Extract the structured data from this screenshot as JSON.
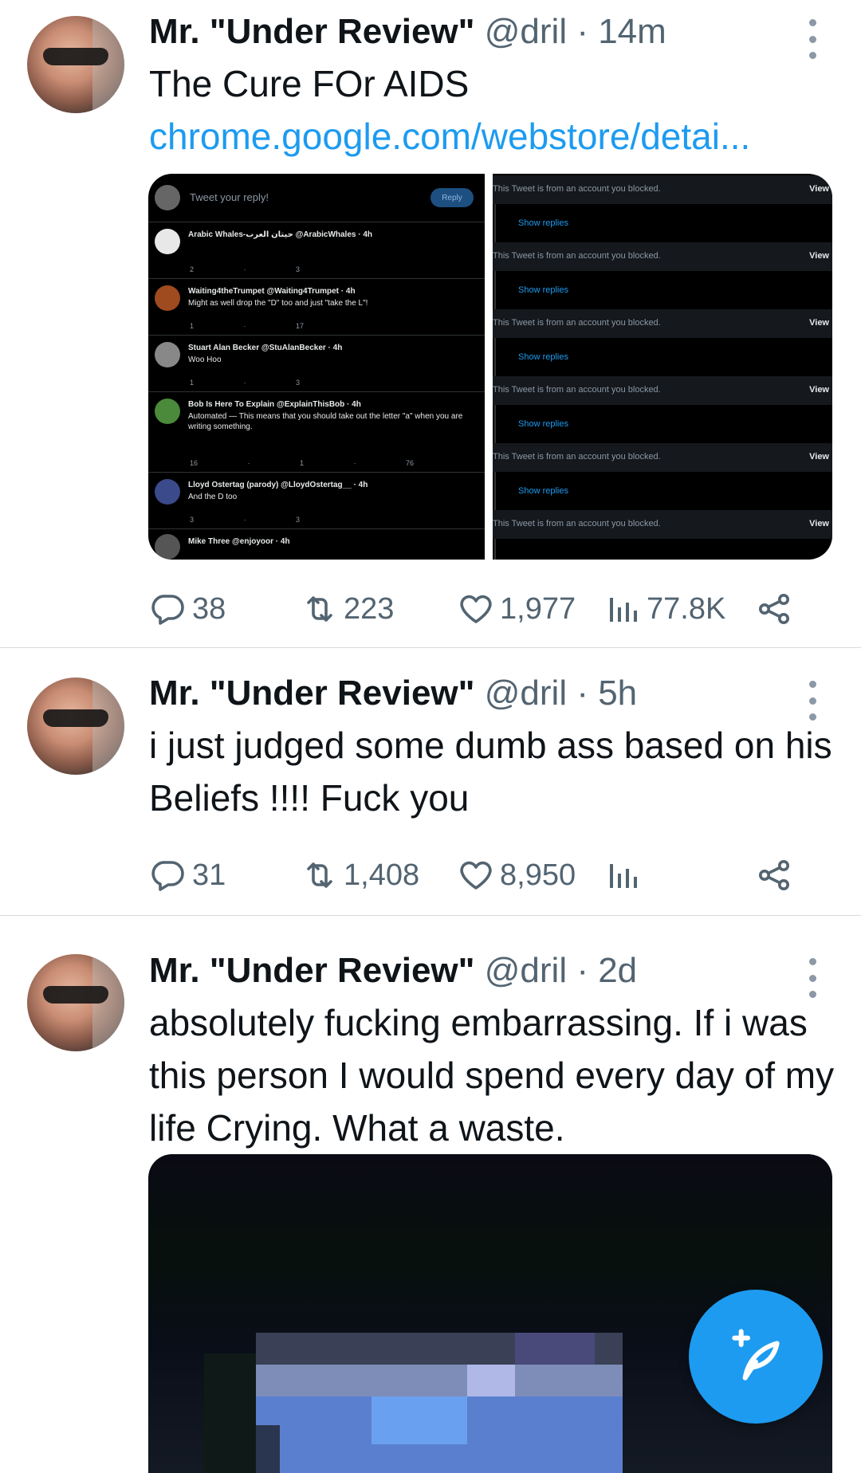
{
  "tweets": [
    {
      "name": "Mr. \"Under Review\"",
      "handle": "@dril",
      "time": "14m",
      "text": "The Cure FOr AIDS",
      "link": "chrome.google.com/webstore/detai...",
      "replies": "38",
      "retweets": "223",
      "likes": "1,977",
      "views": "77.8K"
    },
    {
      "name": "Mr. \"Under Review\"",
      "handle": "@dril",
      "time": "5h",
      "text": "i just judged some dumb ass based on his Beliefs !!!! Fuck you",
      "replies": "31",
      "retweets": "1,408",
      "likes": "8,950",
      "views": ""
    },
    {
      "name": "Mr. \"Under Review\"",
      "handle": "@dril",
      "time": "2d",
      "text": "absolutely fucking embarrassing. If i was this person I would spend every day of my life Crying. What a waste."
    }
  ],
  "media1": {
    "reply_placeholder": "Tweet your reply!",
    "reply_button": "Reply",
    "rows": [
      {
        "name": "Arabic Whales-حيتان العرب @ArabicWhales · 4h",
        "text": "",
        "counts": "2 · 3"
      },
      {
        "name": "Waiting4theTrumpet @Waiting4Trumpet · 4h",
        "text": "Might as well drop the \"D\" too and just \"take the L\"!",
        "counts": "1 · 17"
      },
      {
        "name": "Stuart Alan Becker @StuAlanBecker · 4h",
        "text": "Woo Hoo",
        "counts": "1 · 3"
      },
      {
        "name": "Bob Is Here To Explain @ExplainThisBob · 4h",
        "text": "Automated — This means that you should take out the letter \"a\" when you are writing something.",
        "counts": "16 · 1 · 76"
      },
      {
        "name": "Lloyd Ostertag (parody) @LloydOstertag__ · 4h",
        "text": "And the D too",
        "counts": "3 · 3"
      },
      {
        "name": "Mike Three @enjoyoor · 4h",
        "text": "",
        "counts": ""
      }
    ],
    "blocked_text": "This Tweet is from an account you blocked.",
    "view_label": "View",
    "show_replies": "Show replies"
  }
}
